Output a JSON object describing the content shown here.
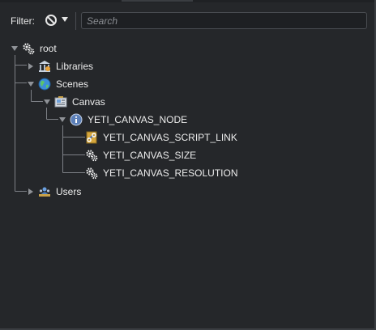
{
  "filter": {
    "label": "Filter:",
    "search_placeholder": "Search",
    "search_value": ""
  },
  "tree": {
    "root": {
      "label": "root",
      "icon": "gears-icon",
      "expanded": true
    },
    "libraries": {
      "label": "Libraries",
      "icon": "library-icon",
      "expanded": false
    },
    "scenes": {
      "label": "Scenes",
      "icon": "globe-icon",
      "expanded": true
    },
    "canvas": {
      "label": "Canvas",
      "icon": "canvas-icon",
      "expanded": true
    },
    "yeti_canvas_node": {
      "label": "YETI_CANVAS_NODE",
      "icon": "info-icon",
      "expanded": true
    },
    "script_link": {
      "label": "YETI_CANVAS_SCRIPT_LINK",
      "icon": "link-icon"
    },
    "canvas_size": {
      "label": "YETI_CANVAS_SIZE",
      "icon": "gears-icon"
    },
    "canvas_resolution": {
      "label": "YETI_CANVAS_RESOLUTION",
      "icon": "gears-icon"
    },
    "users": {
      "label": "Users",
      "icon": "users-icon",
      "expanded": false
    }
  },
  "colors": {
    "background": "#25272a",
    "text": "#ececec",
    "connector": "#7d8086"
  }
}
